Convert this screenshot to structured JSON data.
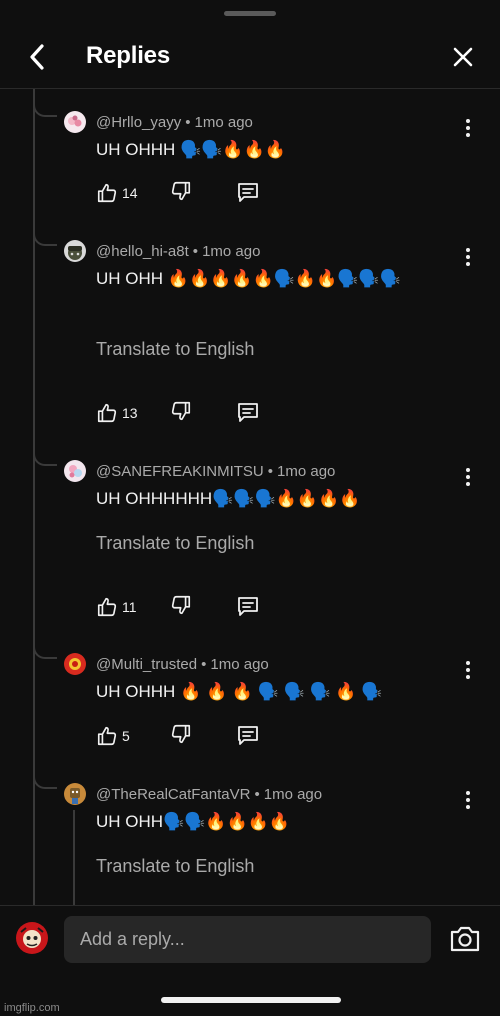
{
  "header": {
    "title": "Replies"
  },
  "comments": [
    {
      "handle": "@Hrllo_yayy",
      "time": "1mo ago",
      "text": "UH OHHH 🗣️🗣️🔥🔥🔥",
      "likes": "14",
      "translate": ""
    },
    {
      "handle": "@hello_hi-a8t",
      "time": "1mo ago",
      "text": "UH OHH 🔥🔥🔥🔥🔥🗣️🔥🔥🗣️🗣️🗣️",
      "likes": "13",
      "translate": "Translate to English"
    },
    {
      "handle": "@SANEFREAKINMITSU",
      "time": "1mo ago",
      "text": "UH OHHHHHH🗣️🗣️🗣️🔥🔥🔥🔥",
      "likes": "11",
      "translate": "Translate to English"
    },
    {
      "handle": "@Multi_trusted",
      "time": "1mo ago",
      "text": "UH OHHH 🔥 🔥 🔥 🗣️ 🗣️ 🗣️ 🔥 🗣️",
      "likes": "5",
      "translate": ""
    },
    {
      "handle": "@TheRealCatFantaVR",
      "time": "1mo ago",
      "text": "UH OHH🗣️🗣️🔥🔥🔥🔥",
      "likes": "",
      "translate": "Translate to English"
    }
  ],
  "reply_box": {
    "placeholder": "Add a reply..."
  },
  "watermark": "imgflip.com",
  "icons": {
    "back": "chevron-left-icon",
    "close": "close-icon",
    "more": "more-vertical-icon",
    "like": "thumbs-up-icon",
    "dislike": "thumbs-down-icon",
    "reply": "reply-comment-icon",
    "camera": "camera-icon"
  },
  "colors": {
    "background": "#0f0f0f",
    "text": "#f1f1f1",
    "secondary": "#aaaaaa",
    "input": "#272727"
  }
}
